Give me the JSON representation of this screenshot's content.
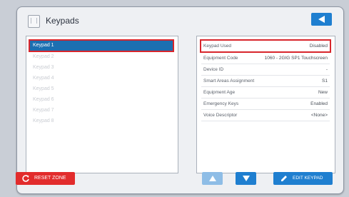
{
  "header": {
    "title": "Keypads"
  },
  "keypads": [
    "Keypad 1",
    "Keypad 2",
    "Keypad 3",
    "Keypad 4",
    "Keypad 5",
    "Keypad 6",
    "Keypad 7",
    "Keypad 8"
  ],
  "details": {
    "rows": [
      {
        "label": "Keypad Used",
        "value": "Disabled"
      },
      {
        "label": "Equipment Code",
        "value": "1060 - 2GIG SP1 Touchscreen"
      },
      {
        "label": "Device ID",
        "value": "-"
      },
      {
        "label": "Smart Areas Assignment",
        "value": "S1"
      },
      {
        "label": "Equipment Age",
        "value": "New"
      },
      {
        "label": "Emergency Keys",
        "value": "Enabled"
      },
      {
        "label": "Voice Descriptor",
        "value": "<None>"
      }
    ]
  },
  "footer": {
    "reset_label": "RESET ZONE",
    "edit_label": "EDIT KEYPAD"
  },
  "colors": {
    "accent": "#1f7fd0",
    "selected": "#1c6fb1",
    "danger": "#e22c2c",
    "highlight_outline": "#d8262c",
    "disabled_button": "#8ebde6"
  },
  "icons": {
    "app": "keypad-device-icon",
    "back": "back-triangle-icon",
    "reset": "refresh-icon",
    "up": "up-arrow-icon",
    "down": "down-arrow-icon",
    "edit": "pencil-icon"
  }
}
